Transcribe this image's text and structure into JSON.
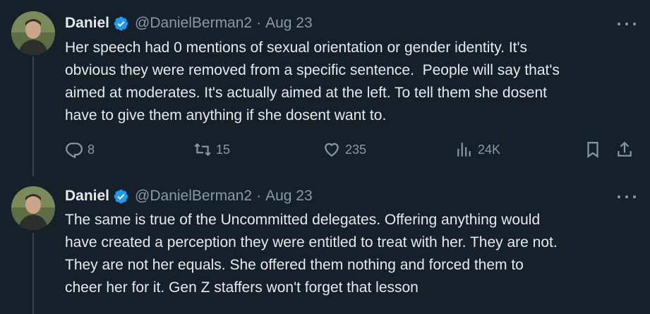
{
  "tweets": [
    {
      "name": "Daniel",
      "handle": "@DanielBerman2",
      "separator": "·",
      "date": "Aug 23",
      "text": "Her speech had 0 mentions of sexual orientation or gender identity. It's\nobvious they were removed from a specific sentence.  People will say that's\naimed at moderates. It's actually aimed at the left. To tell them she dosent\nhave to give them anything if she dosent want to.",
      "replies": "8",
      "retweets": "15",
      "likes": "235",
      "views": "24K"
    },
    {
      "name": "Daniel",
      "handle": "@DanielBerman2",
      "separator": "·",
      "date": "Aug 23",
      "text": "The same is true of the Uncommitted delegates. Offering anything would\nhave created a perception they were entitled to treat with her. They are not.\nThey are not her equals. She offered them nothing and forced them to\ncheer her for it. Gen Z staffers won't forget that lesson"
    }
  ],
  "icons": {
    "verified": "verified-badge-icon",
    "more": "more-dots-icon",
    "reply": "reply-icon",
    "retweet": "retweet-icon",
    "like": "heart-icon",
    "views": "views-chart-icon",
    "bookmark": "bookmark-icon",
    "share": "share-icon"
  },
  "colors": {
    "background": "#15202b",
    "text": "#e7e9ea",
    "secondary": "#8b98a5",
    "verified": "#1d9bf0",
    "thread_line": "#38444d"
  }
}
